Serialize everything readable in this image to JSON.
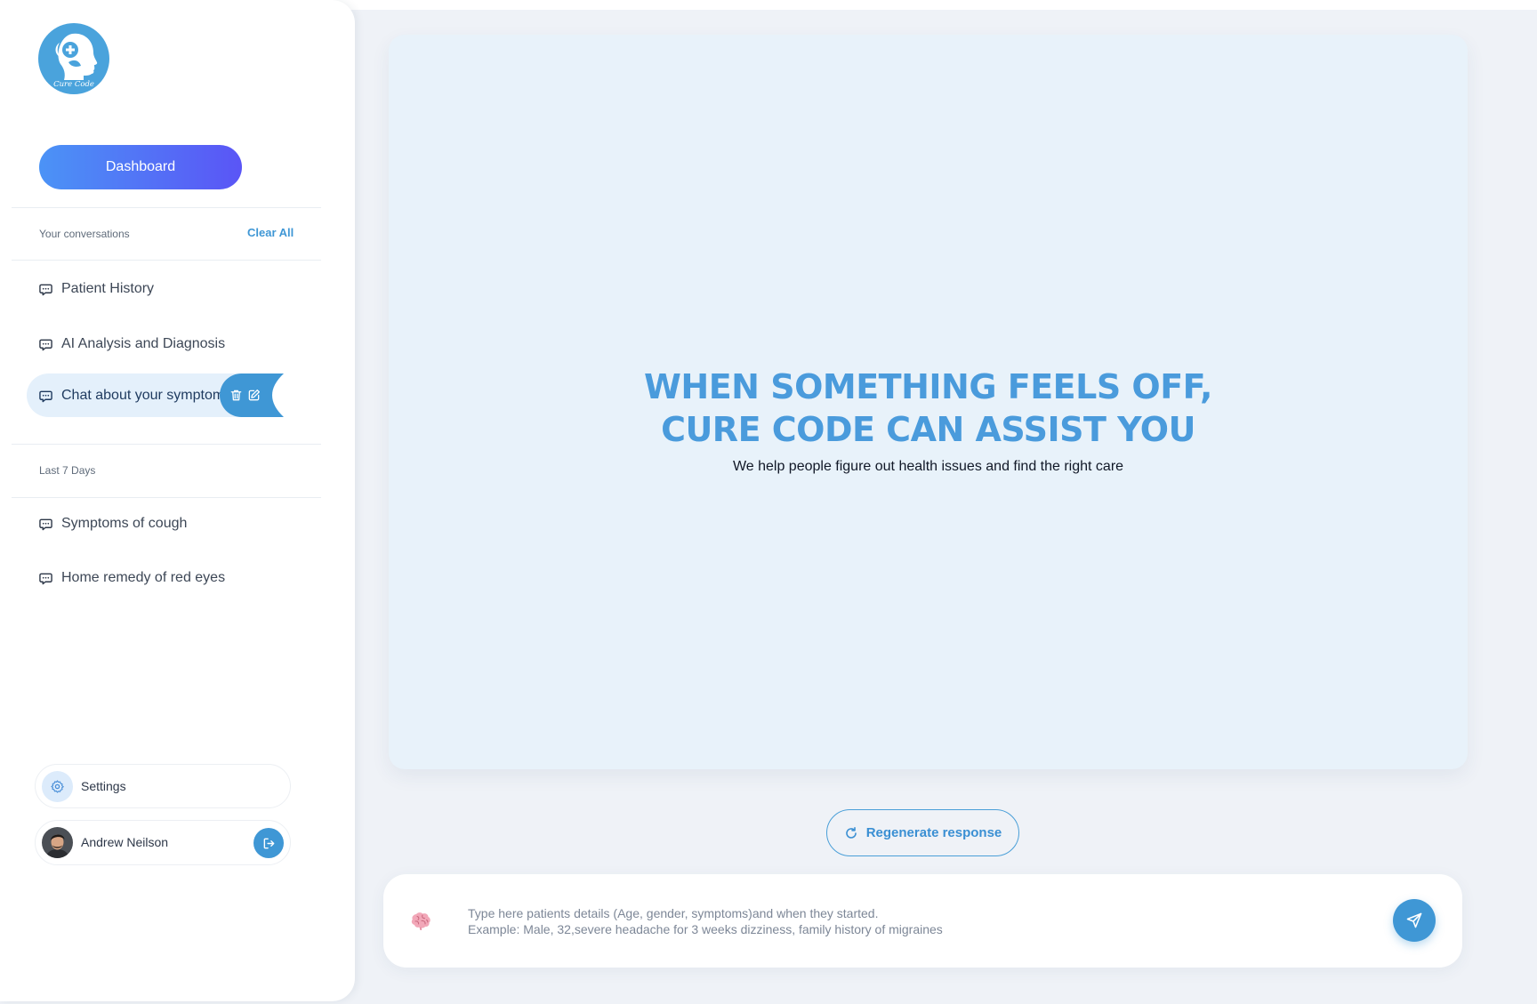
{
  "app": {
    "logo_text": "Cure Code"
  },
  "sidebar": {
    "dashboard_label": "Dashboard",
    "conversations_heading": "Your conversations",
    "clear_all_label": "Clear All",
    "conversations": [
      {
        "label": "Patient History",
        "active": false
      },
      {
        "label": "AI Analysis and Diagnosis",
        "active": false
      },
      {
        "label": "Chat about your symptoms",
        "active": true
      }
    ],
    "recent_heading": "Last 7 Days",
    "recent": [
      {
        "label": "Symptoms of cough"
      },
      {
        "label": "Home remedy of red eyes"
      }
    ],
    "settings_label": "Settings",
    "user": {
      "name": "Andrew Neilson"
    }
  },
  "main": {
    "hero_title_line1": "When something feels off,",
    "hero_title_line2": "Cure Code can assist you",
    "hero_subtitle": "We help people figure out health issues and find the right care",
    "regenerate_label": "Regenerate response",
    "input": {
      "value": "",
      "placeholder": "Type here patients details (Age, gender, symptoms)and when they started.\nExample: Male, 32,severe headache for 3 weeks dizziness, family history of migraines"
    }
  },
  "icons": {
    "logo": "cure-code-logo",
    "conversation_item": "chat-bubble-icon",
    "delete": "trash-icon",
    "rename": "edit-icon",
    "settings": "gear-icon",
    "logout": "logout-icon",
    "regenerate": "refresh-icon",
    "input_prefix": "brain-icon",
    "send": "send-icon"
  },
  "colors": {
    "accent": "#3f97d5",
    "dashboard_gradient_start": "#4b93f6",
    "dashboard_gradient_end": "#5a55f6",
    "hero_title": "#4a9bdc",
    "card_bg": "#e8f2fa",
    "page_bg": "#eff2f7",
    "active_item_bg": "#e4f0fb"
  }
}
